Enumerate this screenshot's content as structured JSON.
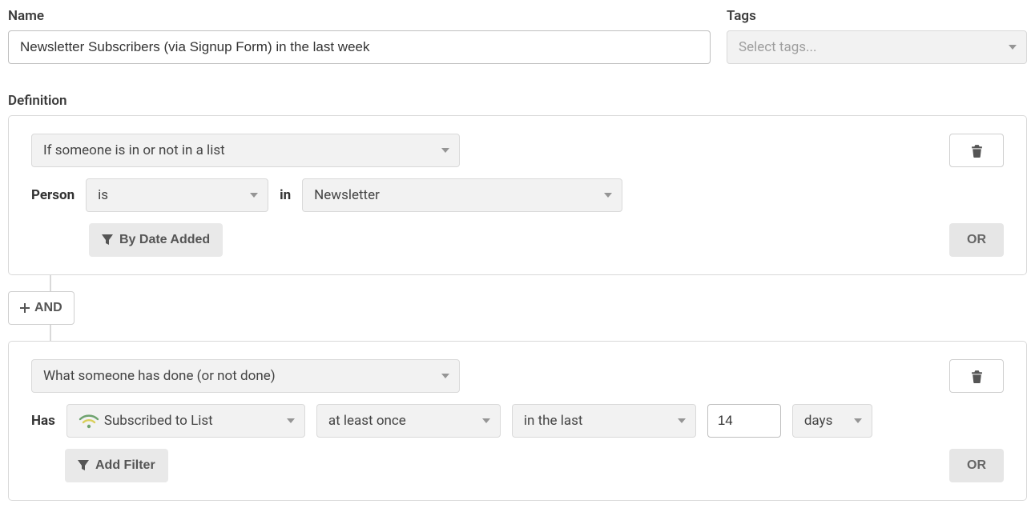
{
  "header": {
    "name_label": "Name",
    "name_value": "Newsletter Subscribers (via Signup Form) in the last week",
    "tags_label": "Tags",
    "tags_placeholder": "Select tags..."
  },
  "definition": {
    "label": "Definition",
    "and_label": "AND",
    "rules": [
      {
        "type_label": "If someone is in or not in a list",
        "person_label": "Person",
        "is_select": "is",
        "in_label": "in",
        "list_select": "Newsletter",
        "date_filter_btn": "By Date Added",
        "or_label": "OR"
      },
      {
        "type_label": "What someone has done (or not done)",
        "has_label": "Has",
        "event_select": "Subscribed to List",
        "freq_select": "at least once",
        "window_select": "in the last",
        "window_value": "14",
        "unit_select": "days",
        "add_filter_btn": "Add Filter",
        "or_label": "OR"
      }
    ]
  }
}
